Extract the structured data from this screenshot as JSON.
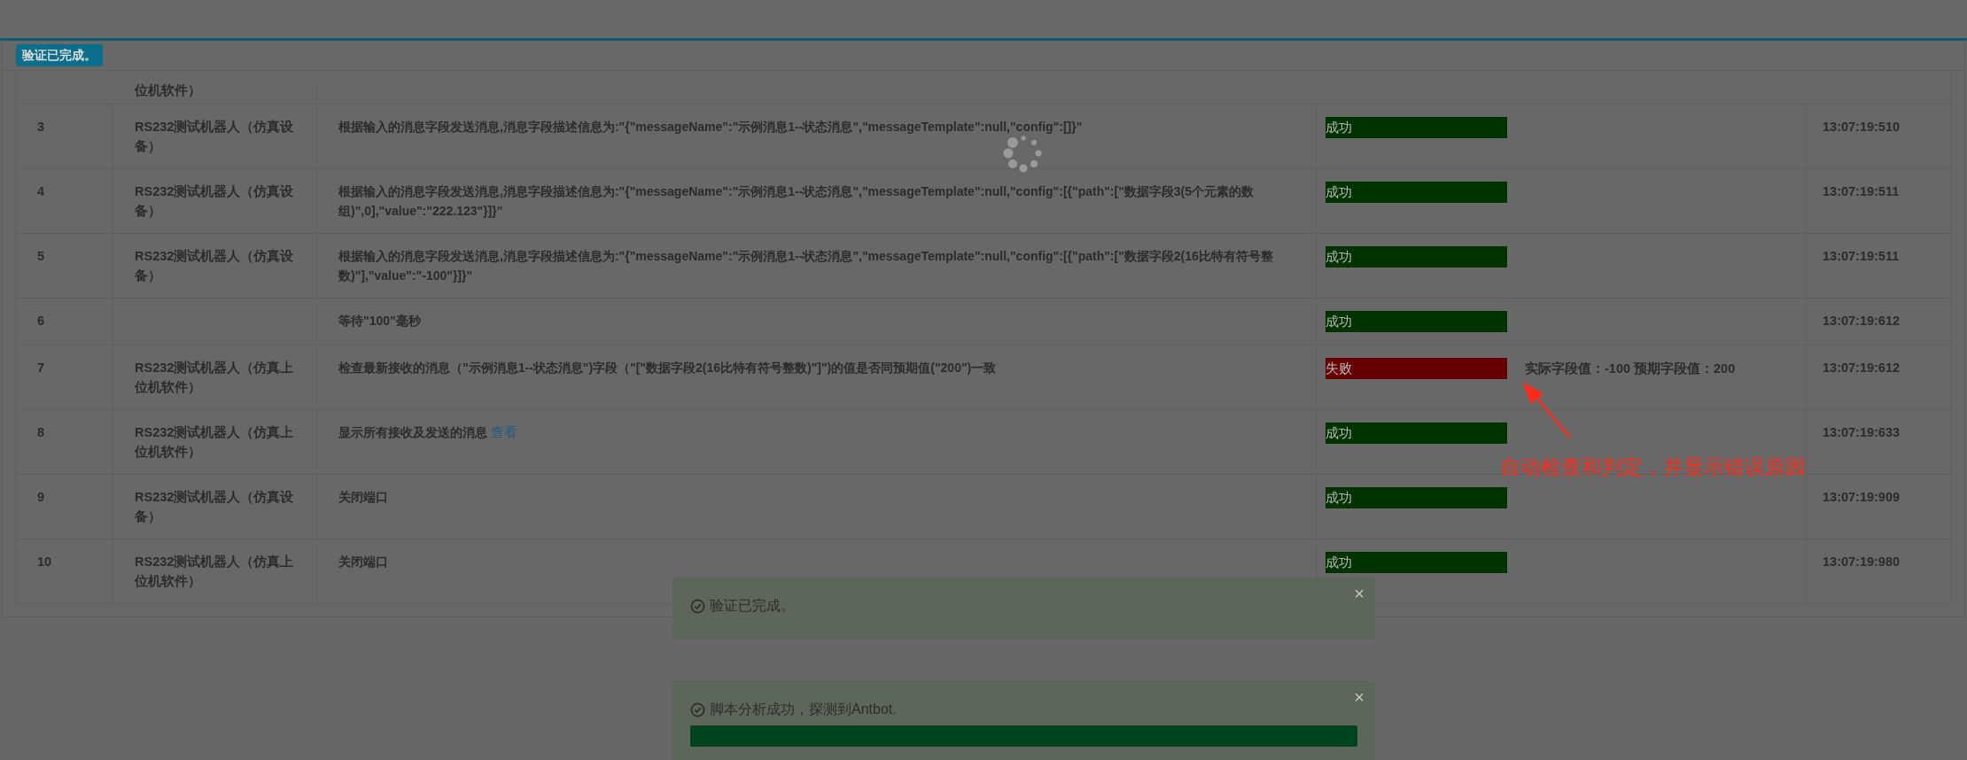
{
  "badge": "验证已完成。",
  "rows": [
    {
      "index": "",
      "robot": "位机软件）",
      "description": "",
      "status": null,
      "detail": "",
      "time": ""
    },
    {
      "index": "3",
      "robot": "RS232测试机器人（仿真设备）",
      "description": "根据输入的消息字段发送消息,消息字段描述信息为:\"{\"messageName\":\"示例消息1--状态消息\",\"messageTemplate\":null,\"config\":[]}\"",
      "status": {
        "kind": "success",
        "label": "成功"
      },
      "detail": "",
      "time": "13:07:19:510"
    },
    {
      "index": "4",
      "robot": "RS232测试机器人（仿真设备）",
      "description": "根据输入的消息字段发送消息,消息字段描述信息为:\"{\"messageName\":\"示例消息1--状态消息\",\"messageTemplate\":null,\"config\":[{\"path\":[\"数据字段3(5个元素的数组)\",0],\"value\":\"222.123\"}]}\"",
      "status": {
        "kind": "success",
        "label": "成功"
      },
      "detail": "",
      "time": "13:07:19:511"
    },
    {
      "index": "5",
      "robot": "RS232测试机器人（仿真设备）",
      "description": "根据输入的消息字段发送消息,消息字段描述信息为:\"{\"messageName\":\"示例消息1--状态消息\",\"messageTemplate\":null,\"config\":[{\"path\":[\"数据字段2(16比特有符号整数)\"],\"value\":\"-100\"}]}\"",
      "status": {
        "kind": "success",
        "label": "成功"
      },
      "detail": "",
      "time": "13:07:19:511"
    },
    {
      "index": "6",
      "robot": "",
      "description": "等待\"100\"毫秒",
      "status": {
        "kind": "success",
        "label": "成功"
      },
      "detail": "",
      "time": "13:07:19:612"
    },
    {
      "index": "7",
      "robot": "RS232测试机器人（仿真上位机软件）",
      "description": "检查最新接收的消息（\"示例消息1--状态消息\")字段（\"[\"数据字段2(16比特有符号整数)\"]\")的值是否同预期值(\"200\")一致",
      "status": {
        "kind": "fail",
        "label": "失败"
      },
      "detail": "实际字段值：-100 预期字段值：200",
      "time": "13:07:19:612"
    },
    {
      "index": "8",
      "robot": "RS232测试机器人（仿真上位机软件）",
      "description": "显示所有接收及发送的消息",
      "link": "查看",
      "status": {
        "kind": "success",
        "label": "成功"
      },
      "detail": "",
      "time": "13:07:19:633"
    },
    {
      "index": "9",
      "robot": "RS232测试机器人（仿真设备）",
      "description": "关闭端口",
      "status": {
        "kind": "success",
        "label": "成功"
      },
      "detail": "",
      "time": "13:07:19:909"
    },
    {
      "index": "10",
      "robot": "RS232测试机器人（仿真上位机软件）",
      "description": "关闭端口",
      "status": {
        "kind": "success",
        "label": "成功"
      },
      "detail": "",
      "time": "13:07:19:980"
    }
  ],
  "annotation": "自动检查和判定，并显示错误原因",
  "toasts": [
    {
      "kind": "plain",
      "message": "验证已完成。",
      "close": "×"
    },
    {
      "kind": "progress",
      "message": "脚本分析成功，探测到Antbot.",
      "close": "×"
    }
  ]
}
